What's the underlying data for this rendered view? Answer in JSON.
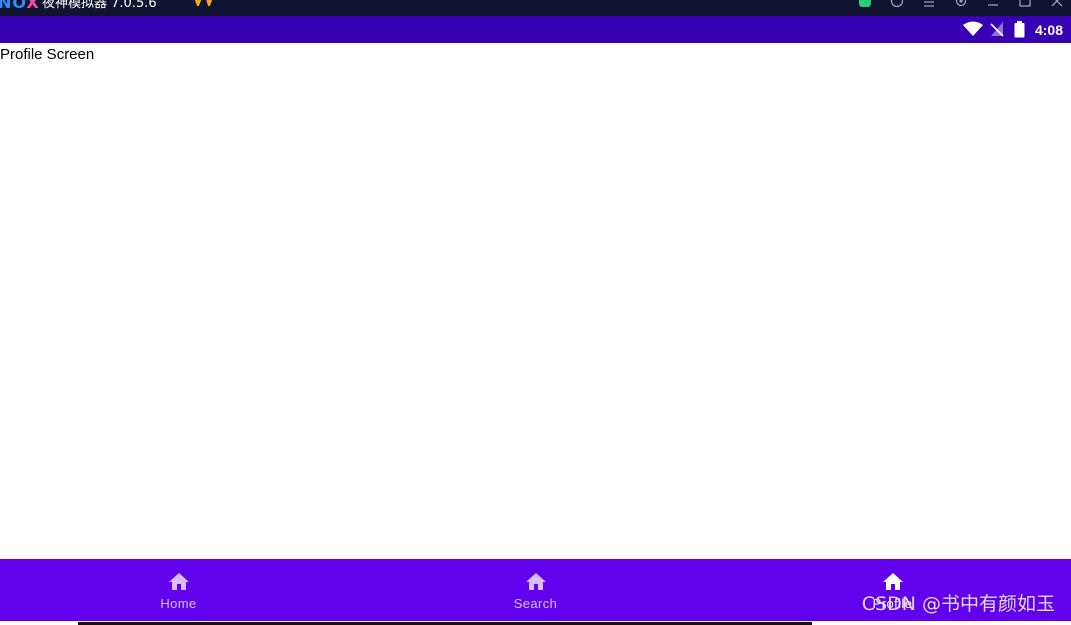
{
  "emulator": {
    "logo": "NOX",
    "title": "夜神模拟器 7.0.5.6"
  },
  "statusbar": {
    "time": "4:08"
  },
  "screen": {
    "label": "Profile Screen"
  },
  "bottom_nav": {
    "items": [
      {
        "label": "Home",
        "icon": "home-icon",
        "active": false
      },
      {
        "label": "Search",
        "icon": "home-icon",
        "active": false
      },
      {
        "label": "Profile",
        "icon": "home-icon",
        "active": true
      }
    ]
  },
  "watermark": {
    "text": "CSDN @书中有颜如玉"
  },
  "colors": {
    "statusbar": "#3700b3",
    "bottom_nav": "#6200ee",
    "emulator_titlebar": "#0f1330"
  }
}
